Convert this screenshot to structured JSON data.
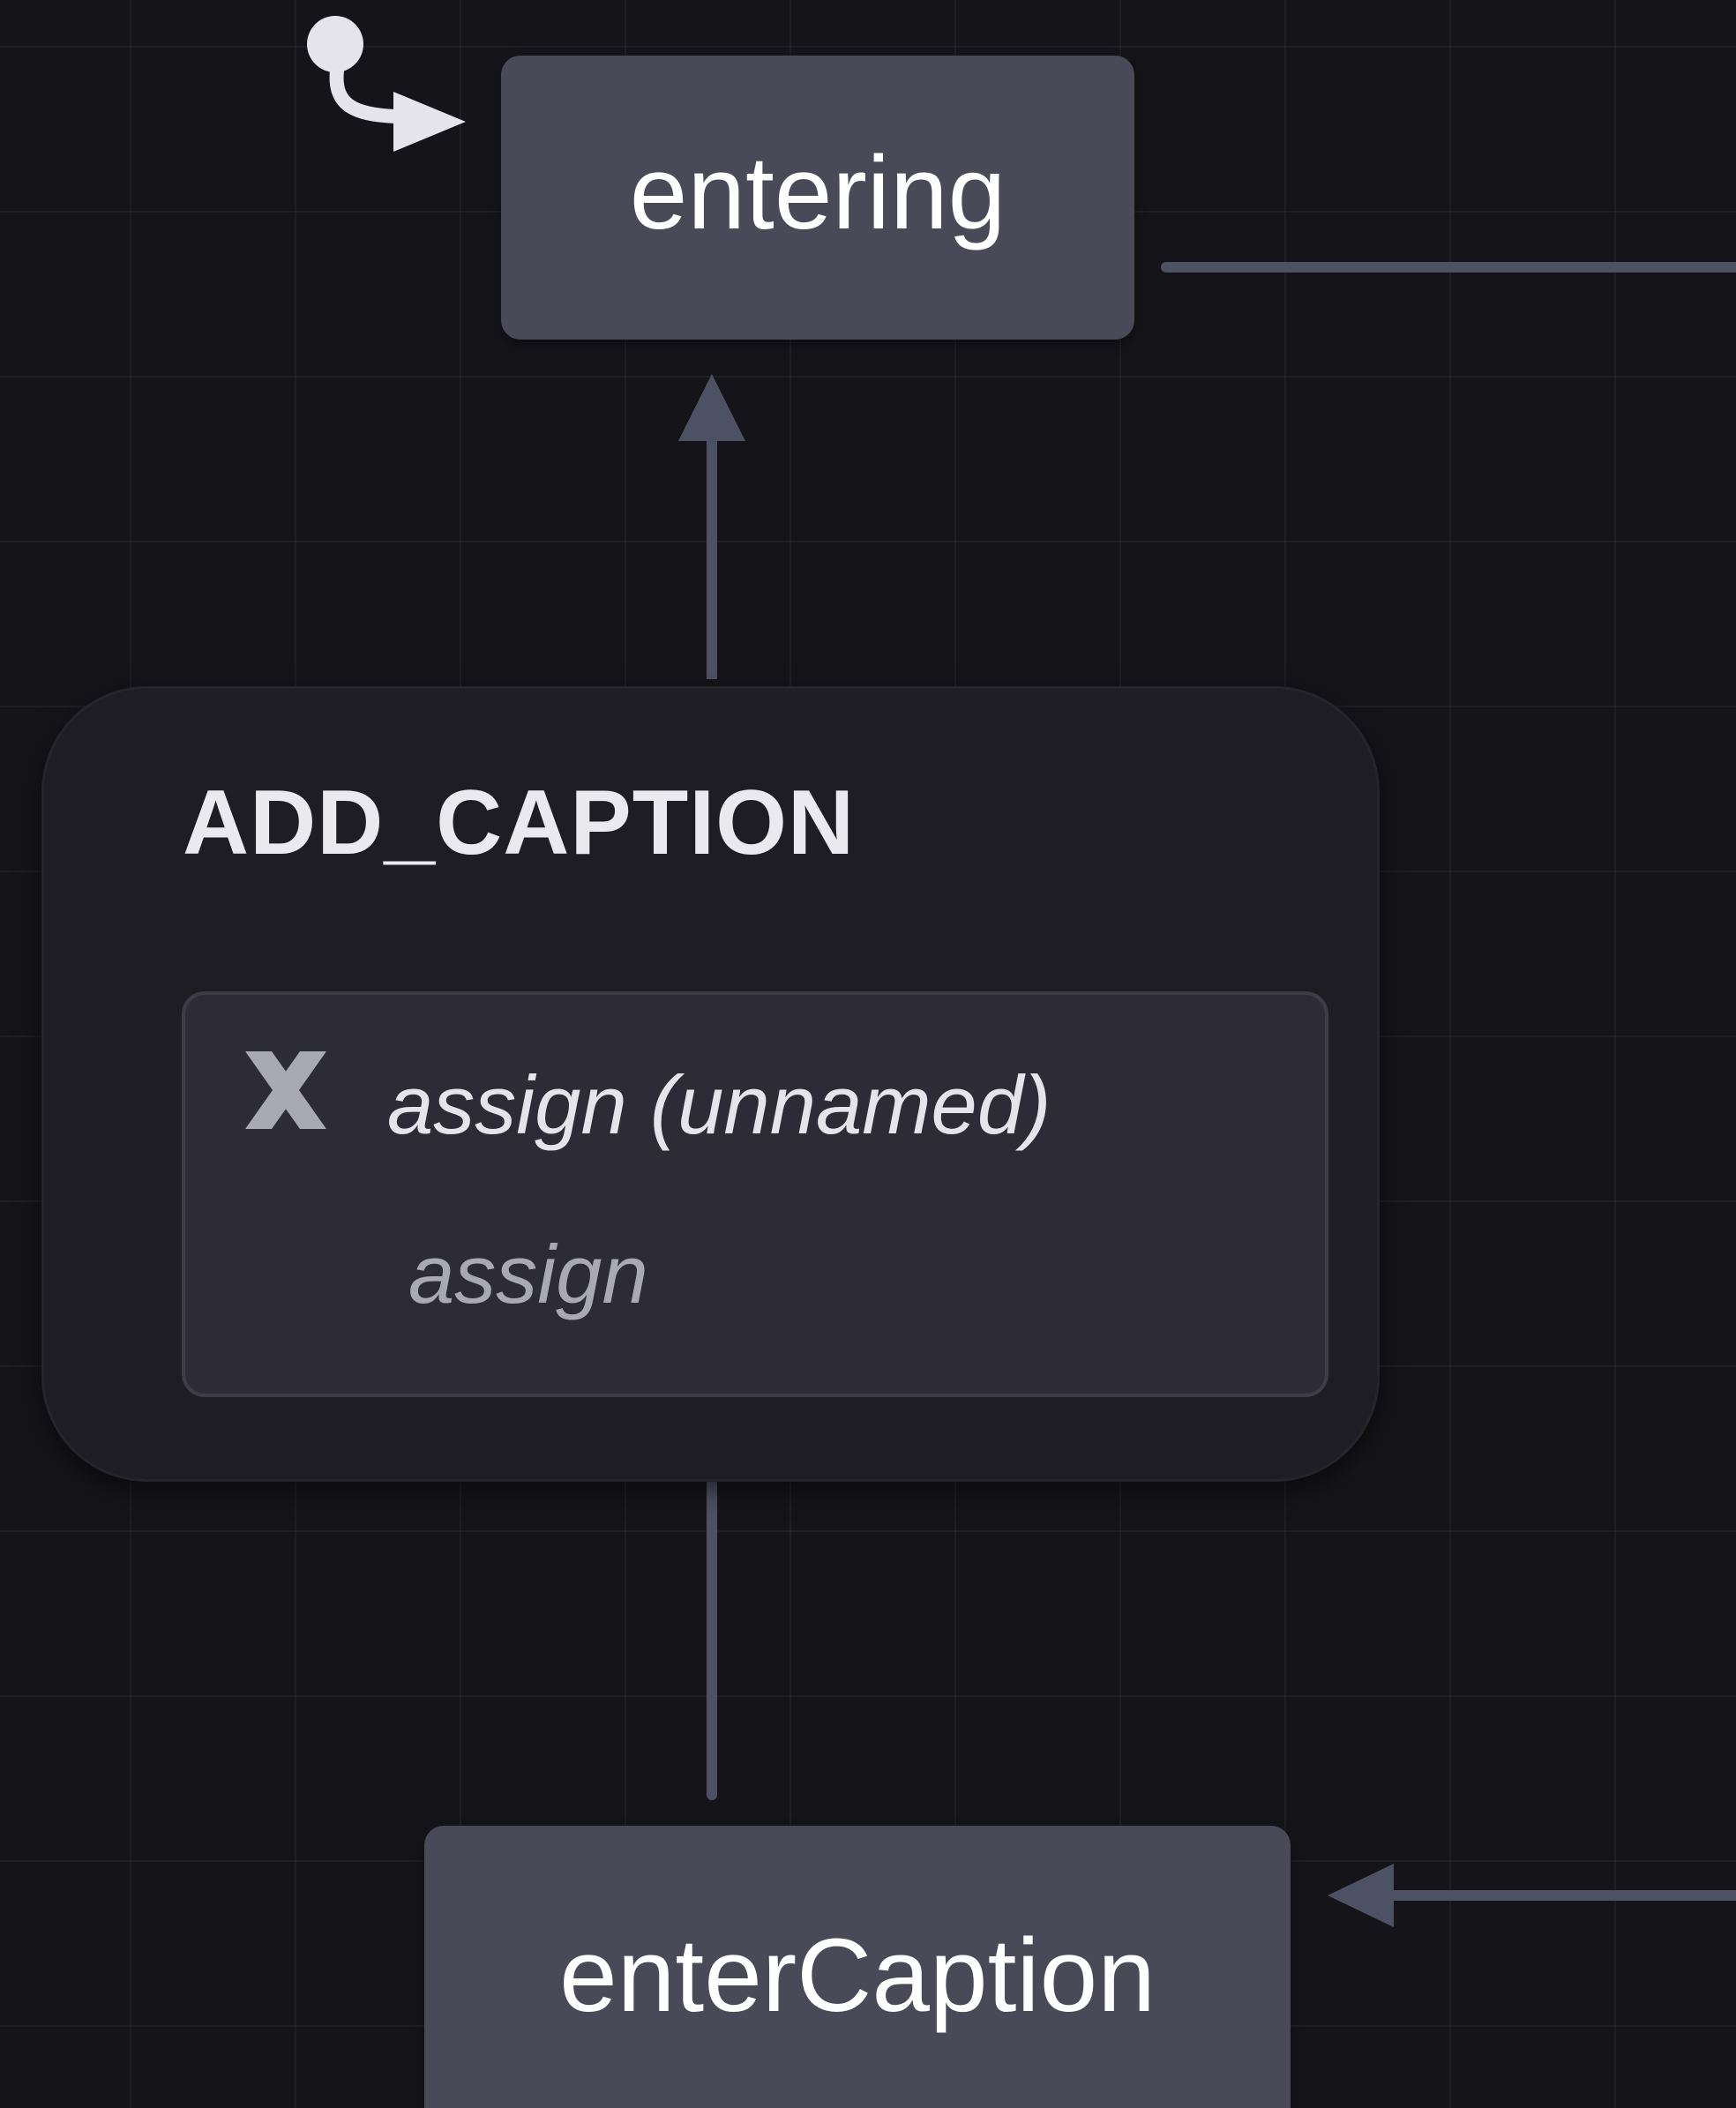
{
  "diagram": {
    "states": {
      "entering": {
        "label": "entering",
        "initial": true
      },
      "enterCaption": {
        "label": "enterCaption"
      }
    },
    "transition_event": {
      "name": "ADD_CAPTION",
      "from": "enterCaption",
      "to": "entering",
      "action": {
        "label": "assign (unnamed)",
        "type": "assign",
        "icon": "xstate-x-icon"
      }
    },
    "colors": {
      "canvas_background": "#151419",
      "state_fill": "#4a4958",
      "event_fill": "#1e1d23",
      "action_fill": "#2d2c36",
      "edge": "#4c5263",
      "initial_marker": "#e4e4ea"
    }
  }
}
